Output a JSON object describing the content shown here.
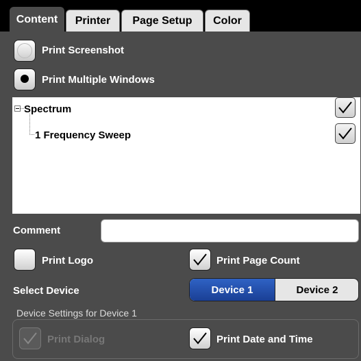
{
  "tabs": [
    {
      "label": "Content",
      "active": true
    },
    {
      "label": "Printer",
      "active": false
    },
    {
      "label": "Page Setup",
      "active": false
    },
    {
      "label": "Color",
      "active": false
    }
  ],
  "print_mode": {
    "screenshot_label": "Print Screenshot",
    "multiple_windows_label": "Print Multiple Windows",
    "selected": "multiple_windows"
  },
  "tree": {
    "items": [
      {
        "label": "Spectrum",
        "checked": true
      },
      {
        "label": "1 Frequency Sweep",
        "checked": true
      }
    ]
  },
  "comment": {
    "label": "Comment",
    "value": ""
  },
  "options": {
    "print_logo": {
      "label": "Print Logo",
      "checked": false
    },
    "print_page_count": {
      "label": "Print Page Count",
      "checked": true
    }
  },
  "device": {
    "label": "Select Device",
    "options": [
      "Device 1",
      "Device 2"
    ],
    "selected": "Device 1"
  },
  "device_settings": {
    "title": "Device Settings for Device 1",
    "print_dialog": {
      "label": "Print Dialog",
      "checked": true,
      "disabled": true
    },
    "print_date_time": {
      "label": "Print Date and Time",
      "checked": true
    }
  },
  "colors": {
    "background": "#4b4b4b",
    "accent": "#2f62c4"
  }
}
